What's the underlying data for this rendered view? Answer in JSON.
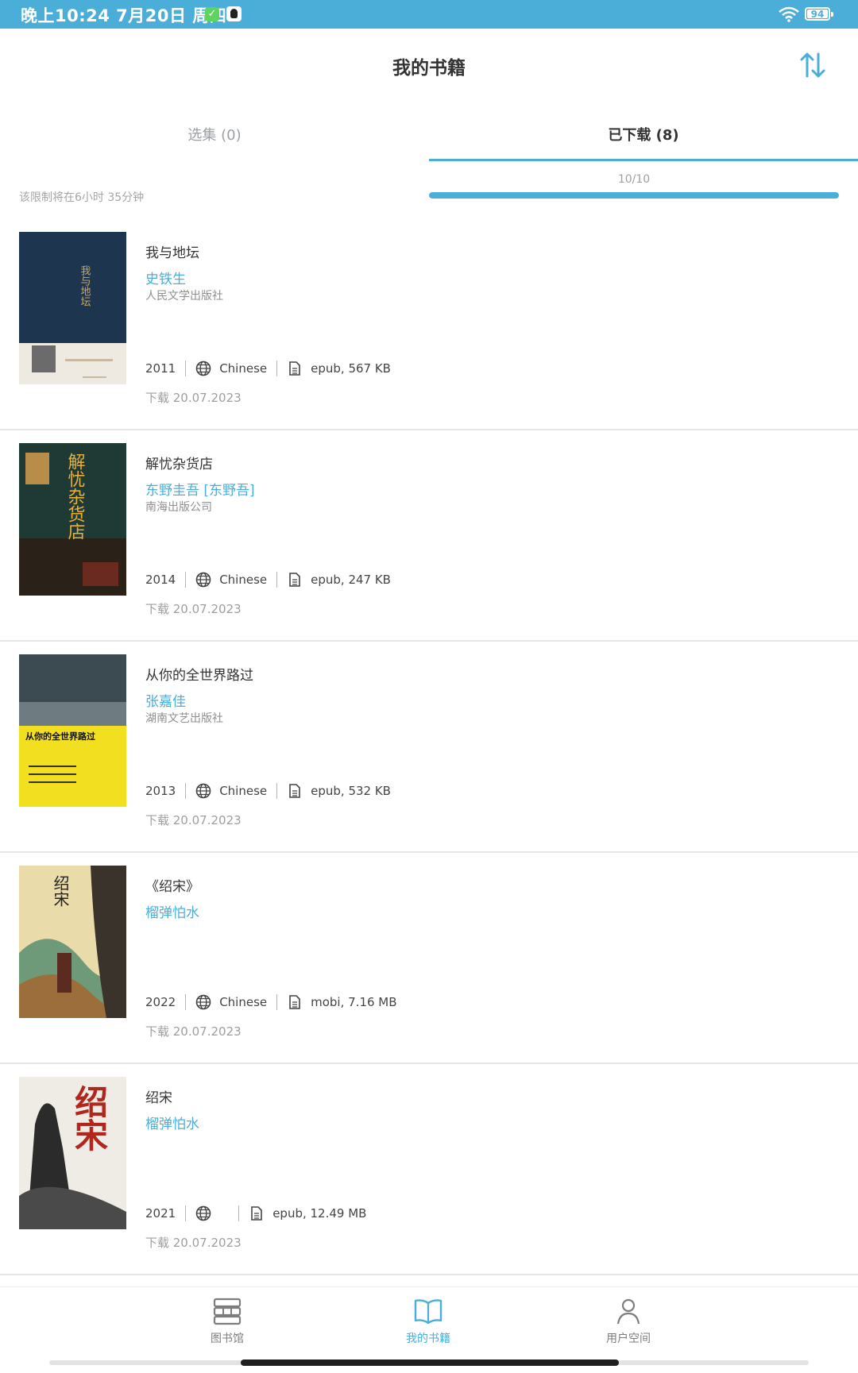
{
  "status_bar": {
    "time": "晚上10:24 7月20日 周四",
    "battery": "94"
  },
  "header": {
    "title": "我的书籍"
  },
  "tabs": [
    {
      "label": "选集 (0)"
    },
    {
      "label": "已下载 (8)"
    }
  ],
  "limit": {
    "text": "该限制将在6小时 35分钟",
    "quota_label": "10/10",
    "quota_fraction": 1.0
  },
  "books": [
    {
      "title": "我与地坛",
      "author": "史铁生",
      "publisher": "人民文学出版社",
      "year": "2011",
      "language": "Chinese",
      "file": "epub, 567 KB",
      "downloaded": "下载 20.07.2023"
    },
    {
      "title": "解忧杂货店",
      "author": "东野圭吾 [东野吾]",
      "publisher": "南海出版公司",
      "year": "2014",
      "language": "Chinese",
      "file": "epub, 247 KB",
      "downloaded": "下载 20.07.2023"
    },
    {
      "title": "从你的全世界路过",
      "author": "张嘉佳",
      "publisher": "湖南文艺出版社",
      "year": "2013",
      "language": "Chinese",
      "file": "epub, 532 KB",
      "downloaded": "下载 20.07.2023"
    },
    {
      "title": "《绍宋》",
      "author": "榴弹怕水",
      "publisher": "",
      "year": "2022",
      "language": "Chinese",
      "file": "mobi, 7.16 MB",
      "downloaded": "下载 20.07.2023"
    },
    {
      "title": "绍宋",
      "author": "榴弹怕水",
      "publisher": "",
      "year": "2021",
      "language": "",
      "file": "epub, 12.49 MB",
      "downloaded": "下载 20.07.2023"
    }
  ],
  "covers": [
    {
      "text": "我与地坛"
    },
    {
      "text": "解忧杂货店"
    },
    {
      "text": "从你的全世界路过"
    },
    {
      "text": "绍宋"
    },
    {
      "text": "绍宋"
    }
  ],
  "bottom_nav": [
    {
      "label": "图书馆",
      "icon": "library-icon"
    },
    {
      "label": "我的书籍",
      "icon": "book-open-icon"
    },
    {
      "label": "用户空间",
      "icon": "user-icon"
    }
  ],
  "colors": {
    "accent": "#4aaed8",
    "text": "#333333",
    "muted": "#9e9e9e"
  }
}
